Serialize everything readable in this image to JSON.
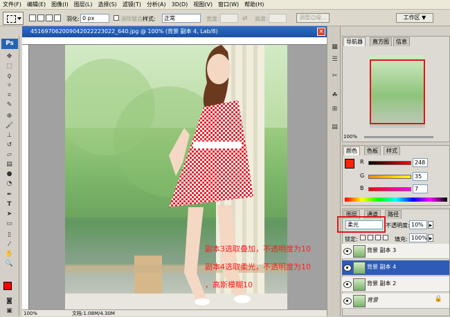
{
  "menu": [
    "文件(F)",
    "编辑(E)",
    "图像(I)",
    "图层(L)",
    "选择(S)",
    "滤镜(T)",
    "分析(A)",
    "3D(D)",
    "视图(V)",
    "窗口(W)",
    "帮助(H)"
  ],
  "options": {
    "feather_label": "羽化:",
    "feather_value": "0 px",
    "antialias_label": "消除锯齿",
    "style_label": "样式:",
    "style_value": "正常",
    "width_label": "宽度:",
    "height_label": "高度:",
    "refine_label": "调整边缘...",
    "workspace_label": "工作区 ▼"
  },
  "document": {
    "title": "451697062009042022223022_640.jpg @ 100% (背景 副本 4, Lab/8)",
    "zoom": "100%",
    "doc_info": "文档:1.08M/4.30M"
  },
  "annotations": [
    "副本3选取叠加，不透明度为10",
    "副本4选取柔光，不透明度为10",
    "，高斯模糊10"
  ],
  "navigator": {
    "tabs": [
      "导航器",
      "直方图",
      "信息"
    ],
    "zoom": "100%"
  },
  "color_panel": {
    "tabs": [
      "颜色",
      "色板",
      "样式"
    ],
    "r_label": "R",
    "r_value": "248",
    "g_label": "G",
    "g_value": "35",
    "b_label": "B",
    "b_value": "7",
    "foreground": "#f82307"
  },
  "layers_panel": {
    "tabs": [
      "图层",
      "通道",
      "路径"
    ],
    "blend_mode": "柔光",
    "opacity_label": "不透明度:",
    "opacity_value": "10%",
    "lock_label": "锁定:",
    "fill_label": "填充:",
    "fill_value": "100%",
    "layers": [
      {
        "name": "背景 副本 3",
        "selected": false
      },
      {
        "name": "背景 副本 4",
        "selected": true
      },
      {
        "name": "背景 副本 2",
        "selected": false
      },
      {
        "name": "背景",
        "selected": false
      }
    ]
  },
  "colors": {
    "accent": "#2d5bb6",
    "annotation": "#ff1e1e",
    "foreground_swatch": "#ff0000"
  }
}
